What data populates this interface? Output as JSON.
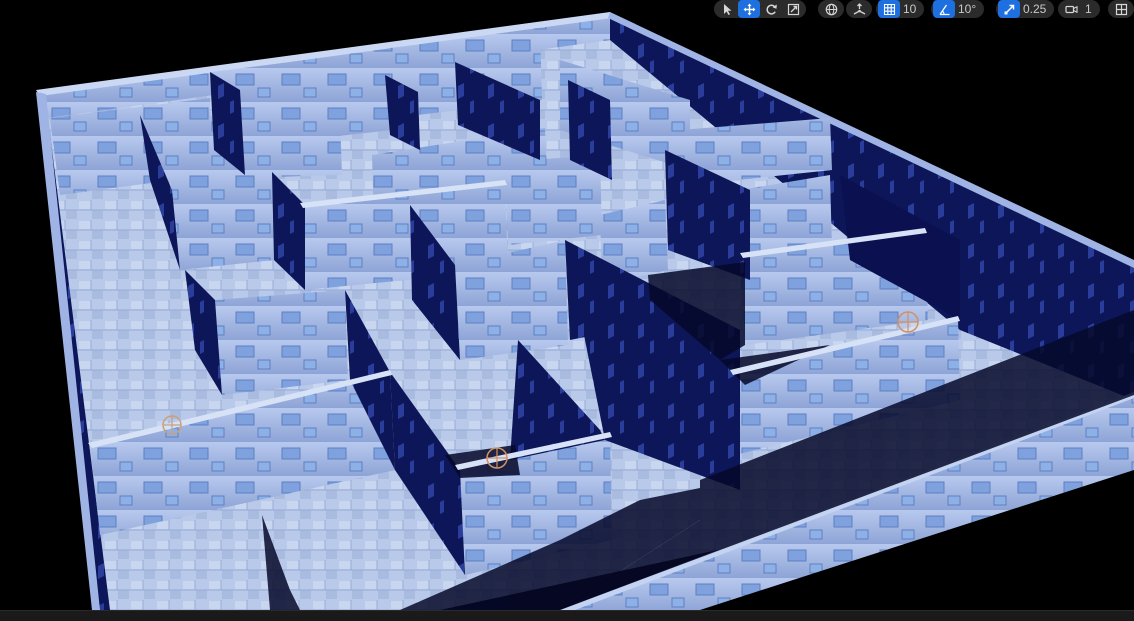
{
  "viewport": {
    "scene": "maze-level",
    "colors": {
      "wall_light": "#a9bde6",
      "wall_shadow": "#0c1457",
      "floor": "#b8c8e8",
      "background": "#000000",
      "accent": "#1e6fe0"
    }
  },
  "toolbar": {
    "grid_snap_value": "10",
    "rotation_snap_value": "10°",
    "scale_snap_value": "0.25",
    "camera_speed_value": "1",
    "icons": [
      "select-icon",
      "translate-icon",
      "rotate-icon",
      "scale-icon",
      "world-local-icon",
      "surface-snap-icon",
      "grid-snap-icon",
      "rotation-snap-icon",
      "scale-snap-icon",
      "camera-speed-icon",
      "viewport-layout-icon"
    ]
  }
}
